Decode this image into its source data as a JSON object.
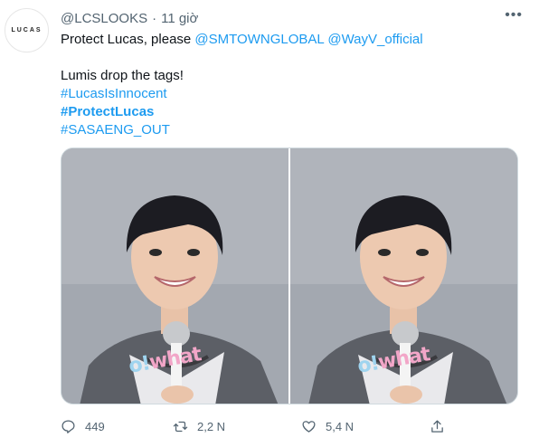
{
  "tweet": {
    "avatar_text": "LUCAS",
    "handle": "@LCSLOOKS",
    "separator": "·",
    "time": "11 giờ",
    "more_label": "•••",
    "line1_text": "Protect Lucas, please ",
    "mention1": "@SMTOWNGLOBAL",
    "mention2": "@WayV_official",
    "line2": "Lumis drop the tags!",
    "hashtag1": "#LucasIsInnocent",
    "hashtag2": "#ProtectLucas",
    "hashtag3": "#SASAENG_OUT",
    "media": [
      {
        "caption_a": "o!",
        "caption_b": "what"
      },
      {
        "caption_a": "o!",
        "caption_b": "what"
      }
    ],
    "actions": {
      "reply_count": "449",
      "retweet_count": "2,2 N",
      "like_count": "5,4 N",
      "share_count": ""
    },
    "colors": {
      "link": "#1d9bf0",
      "muted": "#536471"
    }
  }
}
